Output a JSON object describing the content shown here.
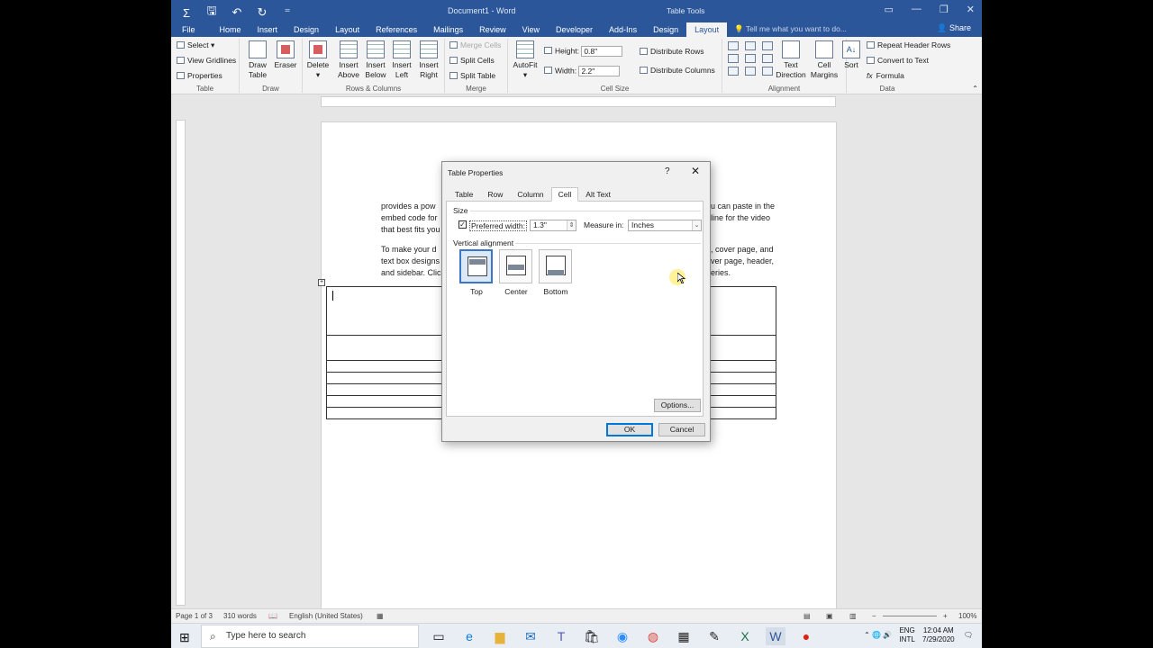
{
  "window": {
    "doc_title": "Document1 - Word",
    "tools_label": "Table Tools",
    "share": "Share",
    "tell_me": "Tell me what you want to do..."
  },
  "tabs": [
    "File",
    "Home",
    "Insert",
    "Design",
    "Layout",
    "References",
    "Mailings",
    "Review",
    "View",
    "Developer",
    "Add-Ins",
    "Design",
    "Layout"
  ],
  "ribbon": {
    "table_group": {
      "select": "Select",
      "view_gridlines": "View Gridlines",
      "properties": "Properties",
      "label": "Table"
    },
    "draw_group": {
      "draw_table": "Draw\nTable",
      "eraser": "Eraser",
      "label": "Draw"
    },
    "rows_cols": {
      "delete": "Delete",
      "insert_above": "Insert\nAbove",
      "insert_below": "Insert\nBelow",
      "insert_left": "Insert\nLeft",
      "insert_right": "Insert\nRight",
      "label": "Rows & Columns"
    },
    "merge": {
      "merge_cells": "Merge Cells",
      "split_cells": "Split Cells",
      "split_table": "Split Table",
      "label": "Merge"
    },
    "cell_size": {
      "autofit": "AutoFit",
      "height_label": "Height:",
      "height_value": "0.8\"",
      "width_label": "Width:",
      "width_value": "2.2\"",
      "distribute_rows": "Distribute Rows",
      "distribute_columns": "Distribute Columns",
      "label": "Cell Size"
    },
    "alignment": {
      "text_direction": "Text\nDirection",
      "cell_margins": "Cell\nMargins",
      "label": "Alignment"
    },
    "data": {
      "sort": "Sort",
      "repeat_header": "Repeat Header Rows",
      "convert_to_text": "Convert to Text",
      "formula": "Formula",
      "label": "Data"
    }
  },
  "document": {
    "para1": [
      " provides a pow",
      "embed code for",
      "that best fits you"
    ],
    "para1_right": [
      "u can paste in the",
      "line for the video",
      ""
    ],
    "para2": [
      "To make your d",
      "text box designs",
      "and sidebar. Clic"
    ],
    "para2_right": [
      ", cover page, and",
      "ver page, header,",
      "eries."
    ]
  },
  "status": {
    "page": "Page 1 of 3",
    "words": "310 words",
    "language": "English (United States)",
    "zoom": "100%"
  },
  "dialog": {
    "title": "Table Properties",
    "help": "?",
    "close": "✕",
    "tabs": [
      "Table",
      "Row",
      "Column",
      "Cell",
      "Alt Text"
    ],
    "active_tab": "Cell",
    "size_label": "Size",
    "preferred_width_label": "Preferred width:",
    "preferred_width_value": "1.3\"",
    "measure_in_label": "Measure in:",
    "measure_in_value": "Inches",
    "vertical_alignment_label": "Vertical alignment",
    "alignments": [
      "Top",
      "Center",
      "Bottom"
    ],
    "selected_alignment": "Top",
    "options_button": "Options...",
    "ok_button": "OK",
    "cancel_button": "Cancel"
  },
  "taskbar": {
    "search_placeholder": "Type here to search",
    "lang": "ENG",
    "layout": "INTL",
    "time": "12:04 AM",
    "date": "7/29/2020"
  }
}
